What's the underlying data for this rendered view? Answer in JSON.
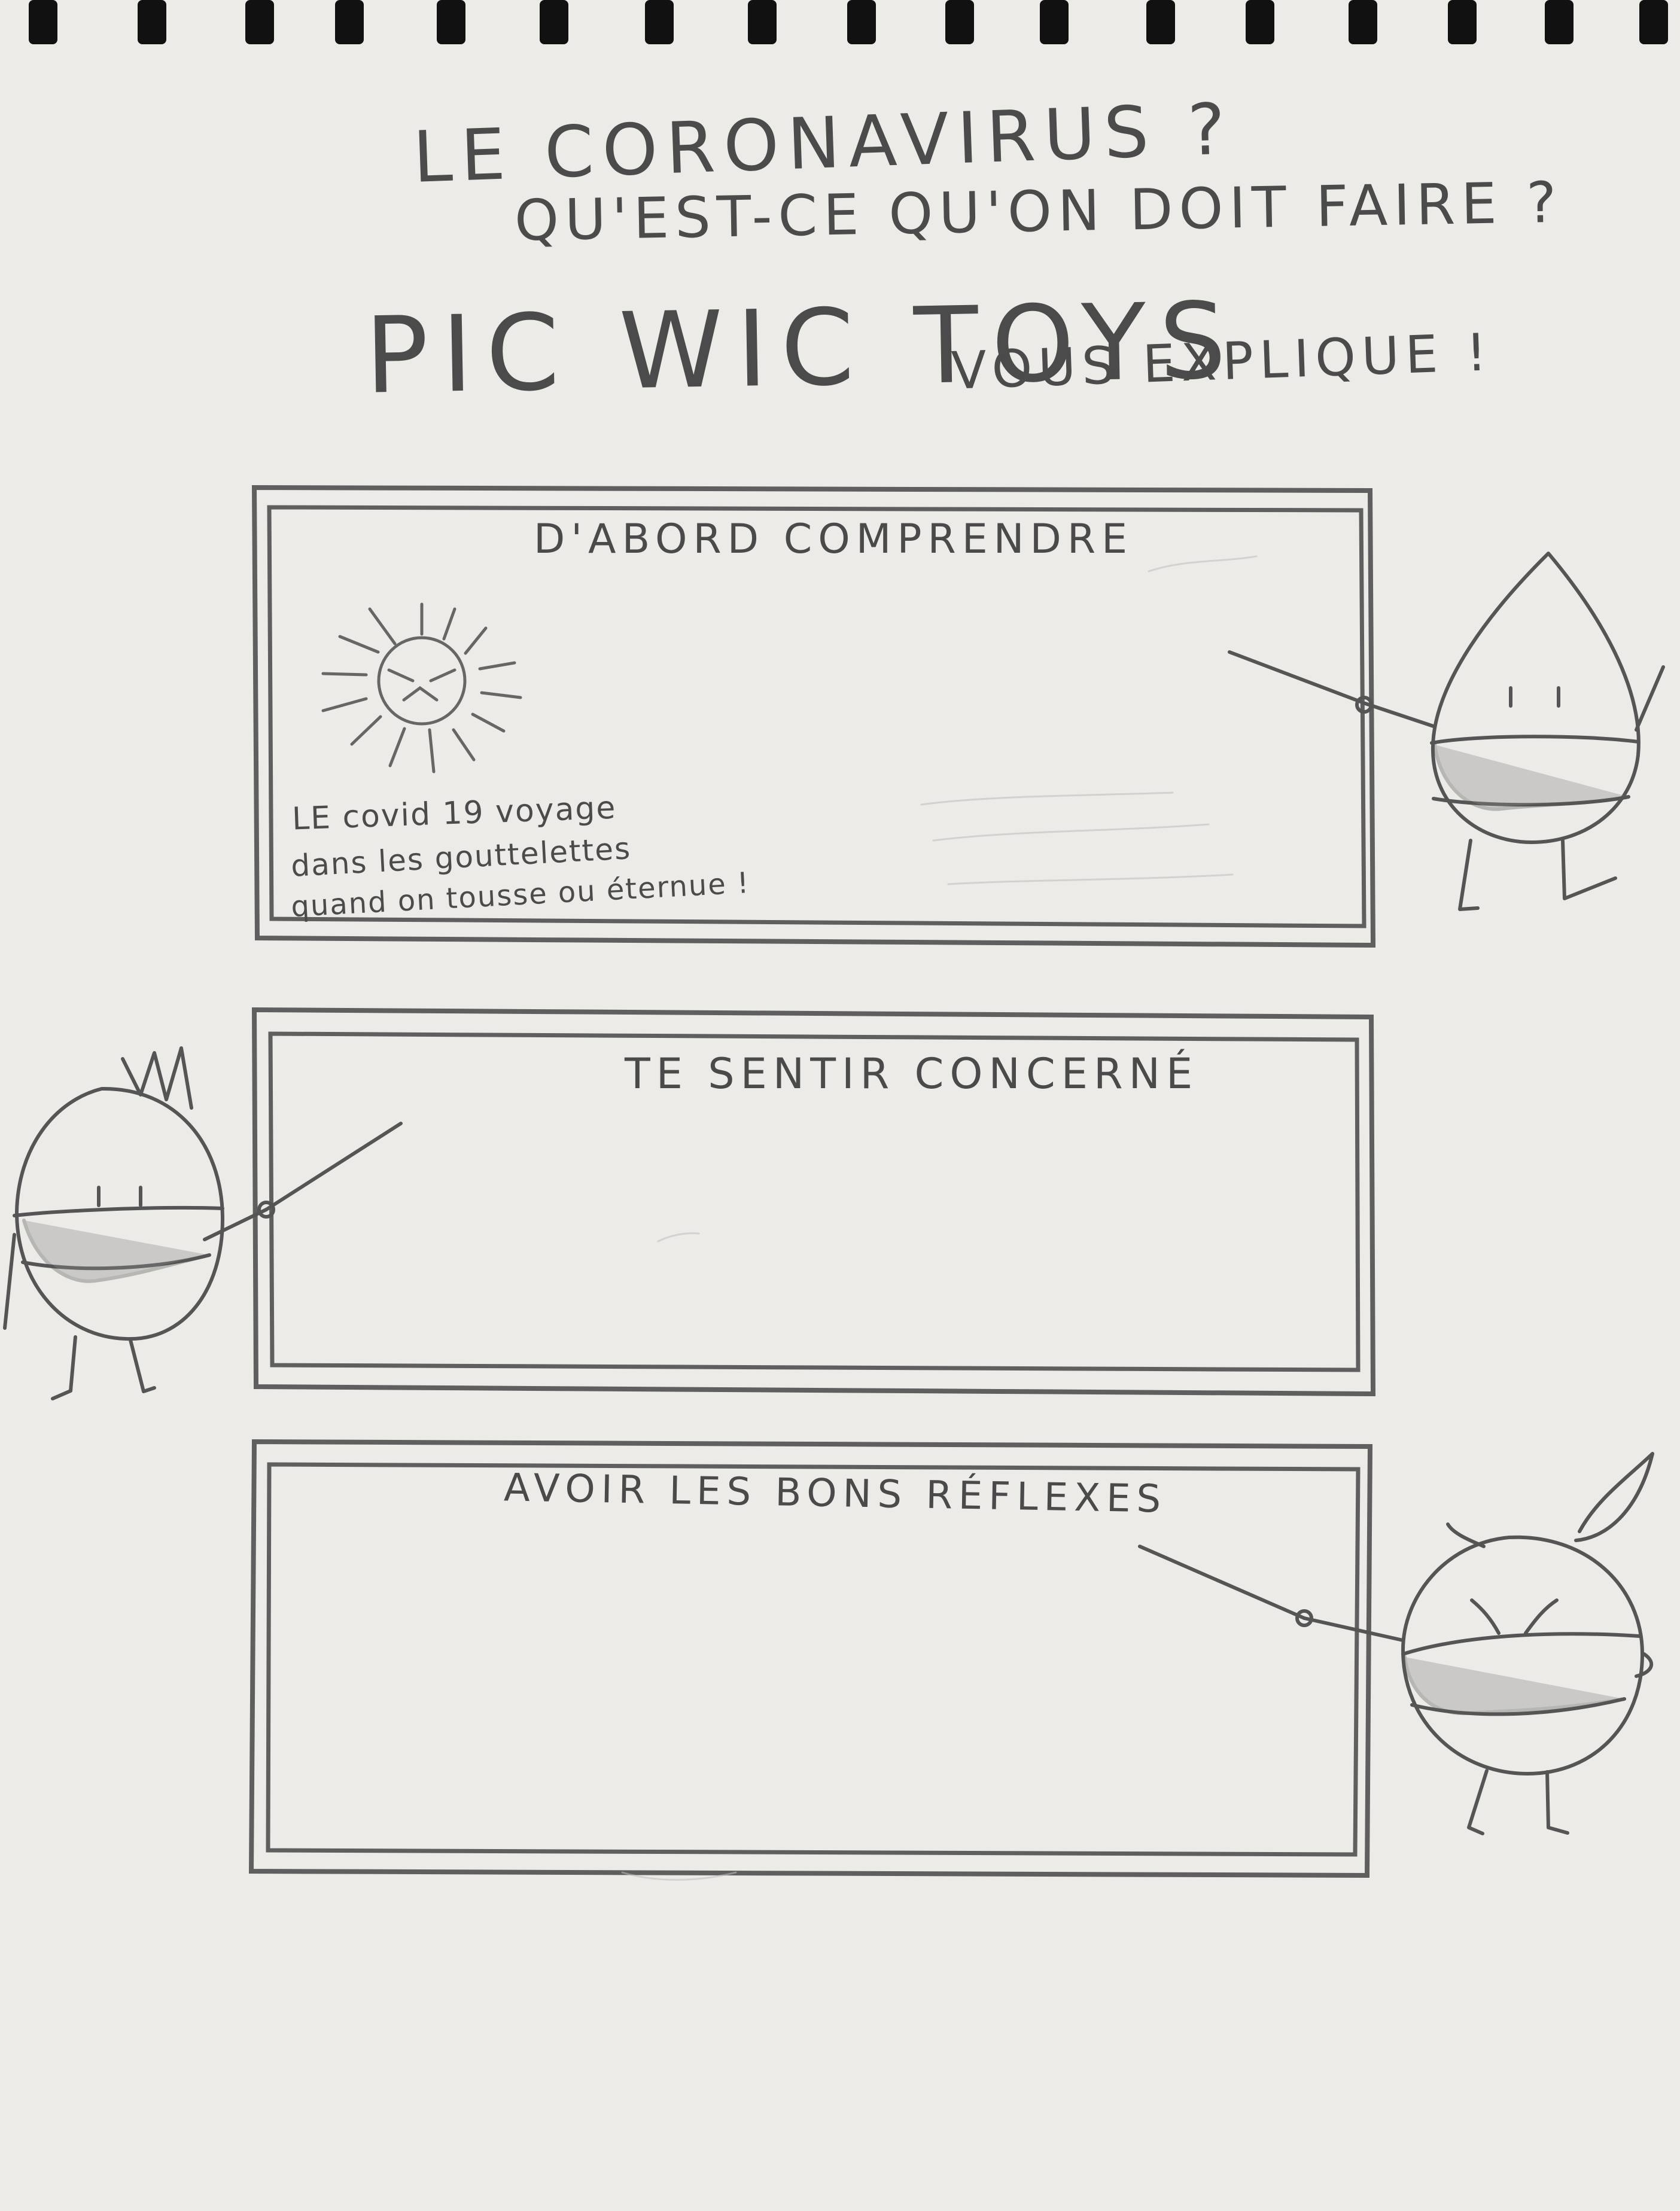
{
  "header": {
    "line_1": "LE CORONAVIRUS ?",
    "line_2": "QU'EST-CE QU'ON DOIT FAIRE ?",
    "brand": "PIC WIC TOYS",
    "brand_tail": "VOUS EXPLIQUE !"
  },
  "panels": [
    {
      "title": "D'ABORD COMPRENDRE",
      "caption_lines": [
        "LE covid 19 voyage",
        "dans les gouttelettes",
        "quand on tousse ou éternue !"
      ]
    },
    {
      "title": "TE SENTIR CONCERNÉ"
    },
    {
      "title": "AVOIR LES BONS RÉFLEXES"
    }
  ],
  "colors": {
    "paper": "#ecebe7",
    "pencil": "#5f5f5f",
    "pencil_dark": "#3f3f3f",
    "mask_shade": "#8d8d8d",
    "spiral": "#111111"
  },
  "icons": {
    "sun": "sun-icon",
    "droplet_character": "droplet-character-icon",
    "spiky_character": "spiky-character-icon",
    "ponytail_character": "ponytail-character-icon"
  }
}
